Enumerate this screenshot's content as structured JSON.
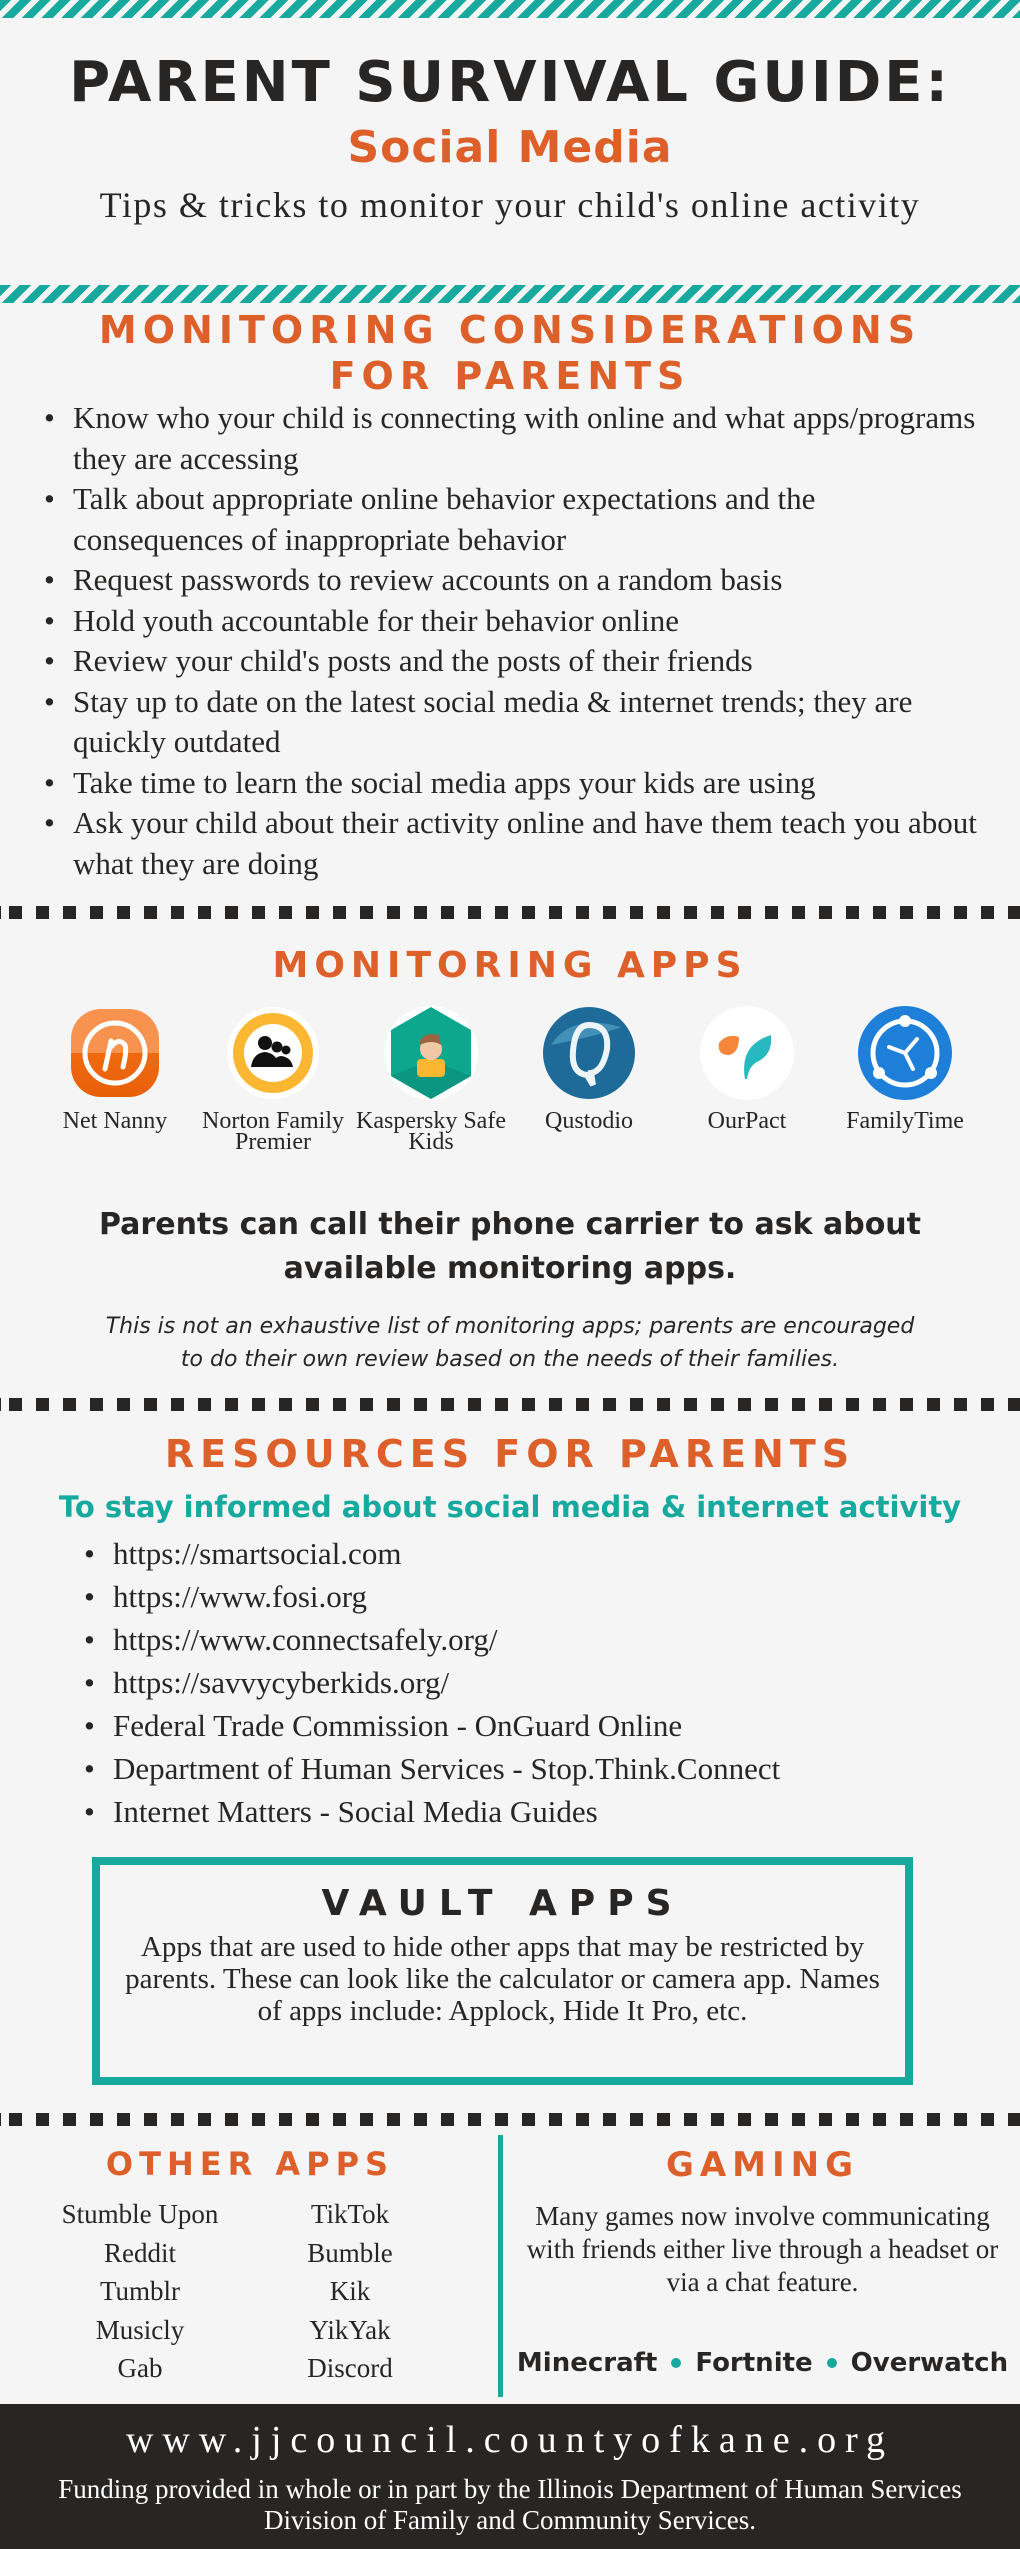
{
  "header": {
    "title": "PARENT SURVIVAL GUIDE:",
    "subtitle": "Social Media",
    "tagline": "Tips & tricks to monitor your child's online activity"
  },
  "considerations": {
    "title": "MONITORING CONSIDERATIONS FOR PARENTS",
    "items": [
      "Know who your child is connecting with online and what apps/programs they are accessing",
      "Talk about appropriate online behavior expectations and the consequences of inappropriate behavior",
      "Request passwords to review accounts on a random basis",
      "Hold youth accountable for their behavior online",
      "Review your child's posts and the posts of their friends",
      "Stay up to date on the latest social media & internet trends; they are quickly outdated",
      "Take time to learn the social media apps your kids are using",
      "Ask your child about their activity online and have them teach you about what they are doing"
    ]
  },
  "monitoring_apps": {
    "title": "MONITORING APPS",
    "apps": [
      {
        "name": "Net Nanny",
        "icon": "net-nanny-icon"
      },
      {
        "name": "Norton Family Premier",
        "icon": "norton-family-icon"
      },
      {
        "name": "Kaspersky Safe Kids",
        "icon": "kaspersky-safe-kids-icon"
      },
      {
        "name": "Qustodio",
        "icon": "qustodio-icon"
      },
      {
        "name": "OurPact",
        "icon": "ourpact-icon"
      },
      {
        "name": "FamilyTime",
        "icon": "familytime-icon"
      }
    ],
    "carrier_note": "Parents can call their phone carrier to ask about available monitoring apps.",
    "disclaimer": "This is not an exhaustive list of monitoring apps; parents are encouraged to do their own review based on the needs of their families."
  },
  "resources": {
    "title": "RESOURCES FOR PARENTS",
    "subtitle": "To stay informed about social media & internet activity",
    "items": [
      "https://smartsocial.com",
      "https://www.fosi.org",
      "https://www.connectsafely.org/",
      "https://savvycyberkids.org/",
      "Federal Trade Commission - OnGuard Online",
      "Department of Human Services - Stop.Think.Connect",
      "Internet Matters - Social Media Guides"
    ]
  },
  "vault": {
    "title": "VAULT APPS",
    "body": "Apps that are used to hide other apps that may be restricted by parents. These can look like the calculator or camera app. Names of apps include: Applock, Hide It Pro, etc."
  },
  "other_apps": {
    "title": "OTHER APPS",
    "left": [
      "Stumble Upon",
      "Reddit",
      "Tumblr",
      "Musicly",
      "Gab"
    ],
    "right": [
      "TikTok",
      "Bumble",
      "Kik",
      "YikYak",
      "Discord"
    ]
  },
  "gaming": {
    "title": "GAMING",
    "body": "Many games now involve communicating with friends either live through a headset or via a chat feature.",
    "games": [
      "Minecraft",
      "Fortnite",
      "Overwatch"
    ]
  },
  "footer": {
    "url": "www.jjcouncil.countyofkane.org",
    "funding": "Funding provided in whole or in part by the Illinois Department of Human Services Division of Family and Community Services."
  },
  "colors": {
    "teal": "#17a89e",
    "orange": "#dd5f2a",
    "dark": "#282625",
    "background": "#f5f5f5"
  }
}
